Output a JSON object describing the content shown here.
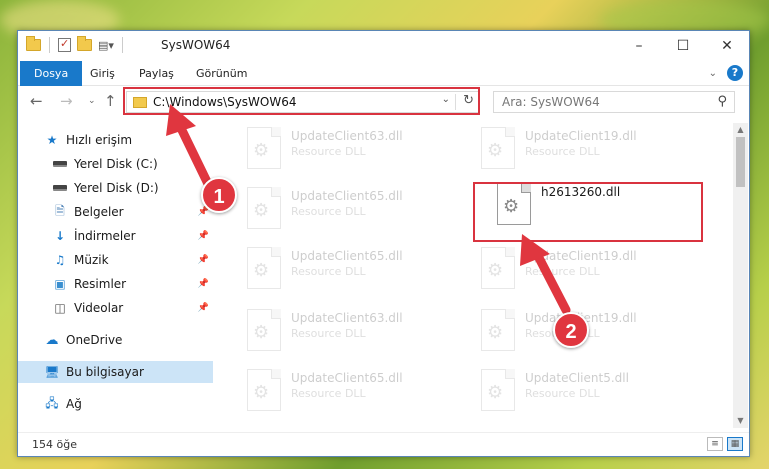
{
  "window": {
    "title": "SysWOW64"
  },
  "ribbon": {
    "tabs": [
      {
        "label": "Dosya",
        "active": true
      },
      {
        "label": "Giriş",
        "active": false
      },
      {
        "label": "Paylaş",
        "active": false
      },
      {
        "label": "Görünüm",
        "active": false
      }
    ]
  },
  "address": {
    "path": "C:\\Windows\\SysWOW64"
  },
  "search": {
    "placeholder": "Ara: SysWOW64"
  },
  "sidebar": {
    "items": [
      {
        "label": "Hızlı erişim",
        "icon": "star-icon"
      },
      {
        "label": "Yerel Disk (C:)",
        "icon": "drive-icon"
      },
      {
        "label": "Yerel Disk (D:)",
        "icon": "drive-icon"
      },
      {
        "label": "Belgeler",
        "icon": "documents-icon"
      },
      {
        "label": "İndirmeler",
        "icon": "download-icon"
      },
      {
        "label": "Müzik",
        "icon": "music-icon"
      },
      {
        "label": "Resimler",
        "icon": "pictures-icon"
      },
      {
        "label": "Videolar",
        "icon": "videos-icon"
      },
      {
        "label": "OneDrive",
        "icon": "cloud-icon"
      },
      {
        "label": "Bu bilgisayar",
        "icon": "computer-icon",
        "selected": true
      },
      {
        "label": "Ağ",
        "icon": "network-icon"
      }
    ]
  },
  "files": [
    {
      "name": "UpdateClient63.dll",
      "type": "Resource DLL"
    },
    {
      "name": "UpdateClient19.dll",
      "type": "Resource DLL"
    },
    {
      "name": "UpdateClient65.dll",
      "type": "Resource DLL"
    },
    {
      "name": "h2613260.dll",
      "type": ""
    },
    {
      "name": "UpdateClient65.dll",
      "type": "Resource DLL"
    },
    {
      "name": "UpdateClient19.dll",
      "type": "Resource DLL"
    },
    {
      "name": "UpdateClient63.dll",
      "type": "Resource DLL"
    },
    {
      "name": "UpdateClient19.dll",
      "type": "Resource DLL"
    },
    {
      "name": "UpdateClient65.dll",
      "type": "Resource DLL"
    },
    {
      "name": "UpdateClient5.dll",
      "type": "Resource DLL"
    }
  ],
  "status": {
    "count": "154 öğe"
  },
  "annotations": {
    "step1": "1",
    "step2": "2",
    "color": "#e0363f"
  }
}
